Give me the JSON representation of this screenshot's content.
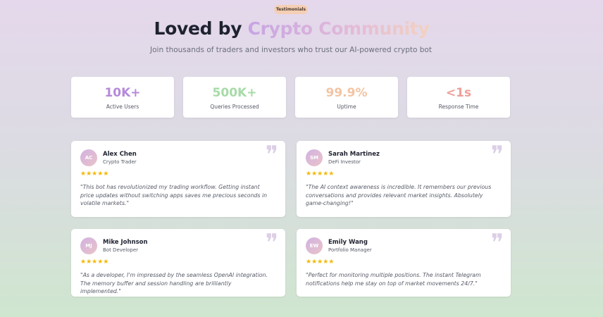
{
  "badge": "Testimonials",
  "title": {
    "part1": "Loved by",
    "part2": "Crypto Community"
  },
  "subtitle": "Join thousands of traders and investors who trust our AI-powered crypto bot",
  "stats": [
    {
      "value": "10K+",
      "label": "Active Users",
      "color": "#b58ad9"
    },
    {
      "value": "500K+",
      "label": "Queries Processed",
      "color": "#a7dba8"
    },
    {
      "value": "99.9%",
      "label": "Uptime",
      "color": "#f2c4a4"
    },
    {
      "value": "<1s",
      "label": "Response Time",
      "color": "#ec9f9a"
    }
  ],
  "testimonials": [
    {
      "initials": "AC",
      "name": "Alex Chen",
      "role": "Crypto Trader",
      "rating": 5,
      "stars": "★★★★★",
      "text": "\"This bot has revolutionized my trading workflow. Getting instant price updates without switching apps saves me precious seconds in volatile markets.\""
    },
    {
      "initials": "SM",
      "name": "Sarah Martinez",
      "role": "DeFi Investor",
      "rating": 5,
      "stars": "★★★★★",
      "text": "\"The AI context awareness is incredible. It remembers our previous conversations and provides relevant market insights. Absolutely game-changing!\""
    },
    {
      "initials": "MJ",
      "name": "Mike Johnson",
      "role": "Bot Developer",
      "rating": 5,
      "stars": "★★★★★",
      "text": "\"As a developer, I'm impressed by the seamless OpenAI integration. The memory buffer and session handling are brilliantly implemented.\""
    },
    {
      "initials": "EW",
      "name": "Emily Wang",
      "role": "Portfolio Manager",
      "rating": 5,
      "stars": "★★★★★",
      "text": "\"Perfect for monitoring multiple positions. The instant Telegram notifications help me stay on top of market movements 24/7.\""
    }
  ],
  "icons": {
    "quote": "quote-icon",
    "star": "star-icon"
  },
  "colors": {
    "star": "#f5b800",
    "quote": "#dccfe6",
    "badge_bg": "#f5cfb4"
  }
}
